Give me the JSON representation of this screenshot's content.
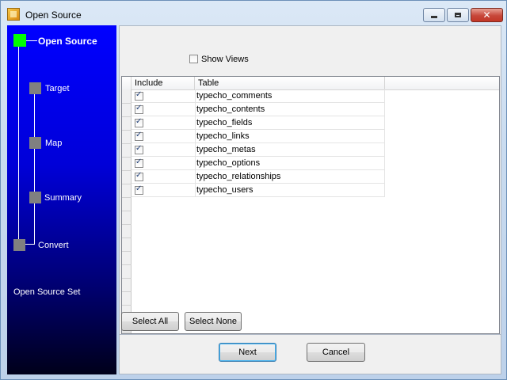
{
  "window": {
    "title": "Open Source"
  },
  "sidebar": {
    "steps": [
      {
        "label": "Open Source",
        "active": true
      },
      {
        "label": "Target",
        "active": false
      },
      {
        "label": "Map",
        "active": false
      },
      {
        "label": "Summary",
        "active": false
      },
      {
        "label": "Convert",
        "active": false
      }
    ],
    "status": "Open Source Set"
  },
  "options": {
    "show_views_label": "Show Views",
    "show_views_checked": false
  },
  "table": {
    "columns": [
      "Include",
      "Table"
    ],
    "rows": [
      {
        "include": true,
        "name": "typecho_comments"
      },
      {
        "include": true,
        "name": "typecho_contents"
      },
      {
        "include": true,
        "name": "typecho_fields"
      },
      {
        "include": true,
        "name": "typecho_links"
      },
      {
        "include": true,
        "name": "typecho_metas"
      },
      {
        "include": true,
        "name": "typecho_options"
      },
      {
        "include": true,
        "name": "typecho_relationships"
      },
      {
        "include": true,
        "name": "typecho_users"
      }
    ]
  },
  "buttons": {
    "select_all": "Select All",
    "select_none": "Select None",
    "next": "Next",
    "cancel": "Cancel"
  },
  "colors": {
    "sidebar_top": "#0000ff",
    "sidebar_bottom": "#00001a",
    "active_step": "#00ff00",
    "inactive_step": "#808080"
  }
}
